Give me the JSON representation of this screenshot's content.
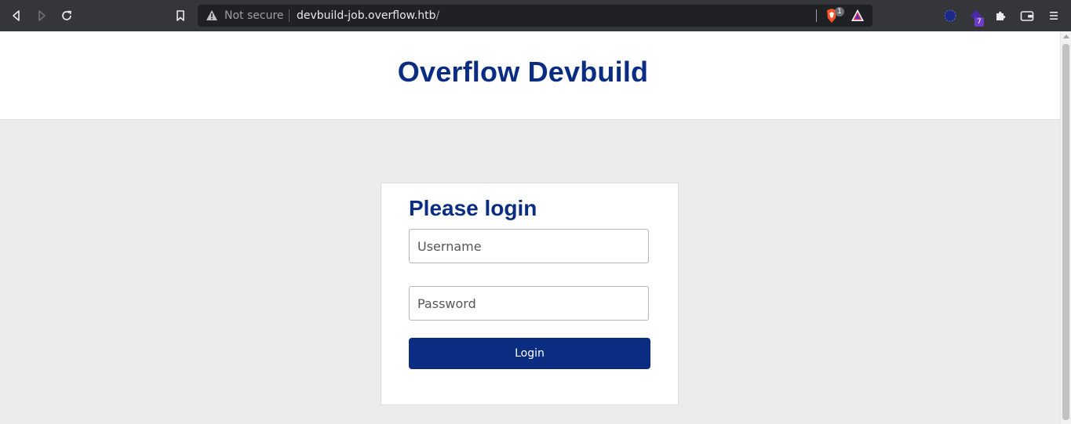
{
  "browser": {
    "omnibox": {
      "security_label": "Not secure",
      "url_host": "devbuild-job.overflow.htb",
      "url_path": "/"
    },
    "shield_count": "1",
    "extension_badge": "7",
    "icons": {
      "back": "back-arrow-icon",
      "forward": "forward-arrow-icon",
      "reload": "reload-icon",
      "bookmark": "bookmark-icon",
      "warning": "warning-icon",
      "shield": "brave-shield-icon",
      "rewards": "brave-rewards-icon",
      "vpn": "vpn-icon",
      "extension": "extension-icon",
      "puzzle": "puzzle-icon",
      "wallet": "wallet-icon",
      "menu": "menu-icon"
    }
  },
  "page": {
    "site_title": "Overflow Devbuild",
    "login": {
      "heading": "Please login",
      "username_placeholder": "Username",
      "password_placeholder": "Password",
      "button_label": "Login"
    }
  },
  "colors": {
    "brand": "#0a2d82",
    "page_background": "#ececec",
    "chrome_background": "#35363a"
  }
}
